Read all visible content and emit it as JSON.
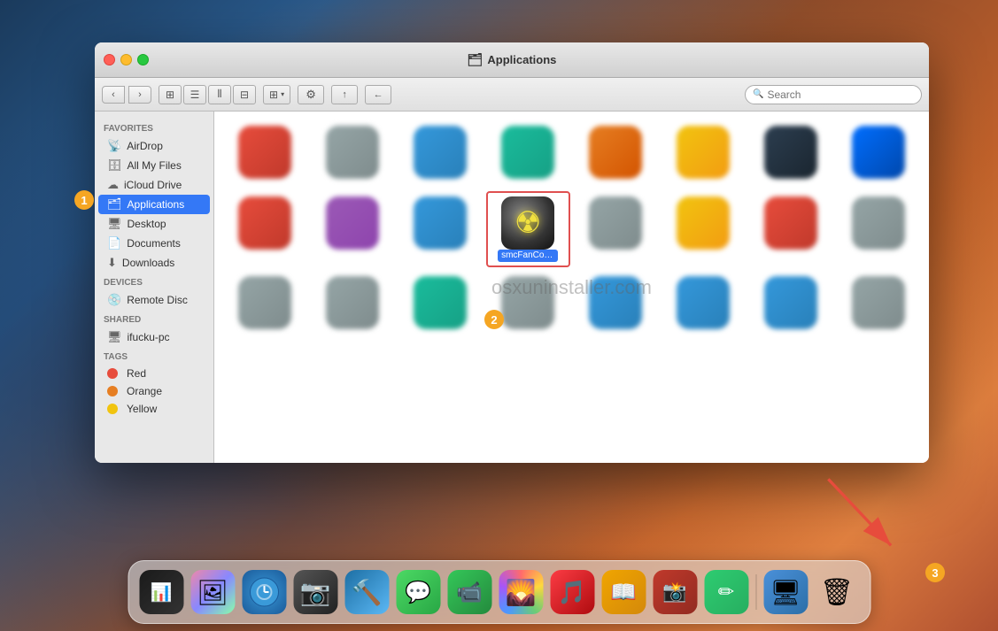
{
  "desktop": {
    "bg_desc": "macOS Sierra mountain wallpaper"
  },
  "window": {
    "title": "Applications",
    "title_icon": "🗂"
  },
  "toolbar": {
    "back_label": "‹",
    "forward_label": "›",
    "view_icon_grid": "⊞",
    "view_icon_list": "≡",
    "view_icon_column": "⫴",
    "view_icon_cover": "⊟",
    "arrange_label": "⊞",
    "action_label": "⚙",
    "share_label": "↑",
    "path_label": "←",
    "search_placeholder": "Search"
  },
  "sidebar": {
    "favorites_header": "Favorites",
    "devices_header": "Devices",
    "shared_header": "Shared",
    "tags_header": "Tags",
    "items": [
      {
        "id": "airdrop",
        "label": "AirDrop",
        "icon": "📡"
      },
      {
        "id": "all-my-files",
        "label": "All My Files",
        "icon": "🗄"
      },
      {
        "id": "icloud-drive",
        "label": "iCloud Drive",
        "icon": "☁"
      },
      {
        "id": "applications",
        "label": "Applications",
        "icon": "🗂",
        "active": true
      },
      {
        "id": "desktop",
        "label": "Desktop",
        "icon": "🖥"
      },
      {
        "id": "documents",
        "label": "Documents",
        "icon": "📄"
      },
      {
        "id": "downloads",
        "label": "Downloads",
        "icon": "⬇"
      },
      {
        "id": "remote-disc",
        "label": "Remote Disc",
        "icon": "💿"
      },
      {
        "id": "ifucku-pc",
        "label": "ifucku-pc",
        "icon": "🖥"
      }
    ],
    "tags": [
      {
        "id": "red",
        "label": "Red",
        "color": "#e74c3c"
      },
      {
        "id": "orange",
        "label": "Orange",
        "color": "#e67e22"
      },
      {
        "id": "yellow",
        "label": "Yellow",
        "color": "#f1c40f"
      }
    ]
  },
  "apps_grid": [
    {
      "id": "app1",
      "label": "",
      "icon_type": "blurred",
      "color": "icon-red"
    },
    {
      "id": "app2",
      "label": "",
      "icon_type": "blurred",
      "color": "icon-gray"
    },
    {
      "id": "app3",
      "label": "",
      "icon_type": "blurred",
      "color": "icon-blue"
    },
    {
      "id": "app4",
      "label": "",
      "icon_type": "blurred",
      "color": "icon-teal"
    },
    {
      "id": "app5",
      "label": "",
      "icon_type": "blurred",
      "color": "icon-orange"
    },
    {
      "id": "app6",
      "label": "",
      "icon_type": "blurred",
      "color": "icon-yellow"
    },
    {
      "id": "app7",
      "label": "",
      "icon_type": "blurred",
      "color": "icon-darkblue"
    },
    {
      "id": "app8",
      "label": "",
      "icon_type": "blurred",
      "color": "icon-safari"
    },
    {
      "id": "app9",
      "label": "",
      "icon_type": "blurred",
      "color": "icon-red"
    },
    {
      "id": "app10",
      "label": "",
      "icon_type": "blurred",
      "color": "icon-purple"
    },
    {
      "id": "app11",
      "label": "",
      "icon_type": "blurred",
      "color": "icon-blue"
    },
    {
      "id": "app12",
      "label": "",
      "icon_type": "blurred",
      "color": "icon-photos"
    },
    {
      "id": "app13",
      "label": "",
      "icon_type": "blurred",
      "color": "icon-teal"
    },
    {
      "id": "app14",
      "label": "",
      "icon_type": "blurred",
      "color": "icon-gray"
    },
    {
      "id": "app15",
      "label": "",
      "icon_type": "blurred",
      "color": "icon-gray"
    },
    {
      "id": "app16",
      "label": "",
      "icon_type": "blurred",
      "color": "icon-safari"
    },
    {
      "id": "smcfancontrol",
      "label": "smcFanControl",
      "icon_type": "smc",
      "selected": true
    },
    {
      "id": "app18",
      "label": "",
      "icon_type": "blurred",
      "color": "icon-red"
    },
    {
      "id": "app19",
      "label": "",
      "icon_type": "blurred",
      "color": "icon-pink"
    },
    {
      "id": "app20",
      "label": "",
      "icon_type": "blurred",
      "color": "icon-gray"
    },
    {
      "id": "app21",
      "label": "",
      "icon_type": "blurred",
      "color": "icon-red"
    },
    {
      "id": "app22",
      "label": "",
      "icon_type": "blurred",
      "color": "icon-yellow"
    },
    {
      "id": "app23",
      "label": "",
      "icon_type": "blurred",
      "color": "icon-gray"
    },
    {
      "id": "app24",
      "label": "",
      "icon_type": "blurred",
      "color": "icon-gray"
    },
    {
      "id": "app25",
      "label": "",
      "icon_type": "blurred",
      "color": "icon-gray"
    },
    {
      "id": "app26",
      "label": "",
      "icon_type": "blurred",
      "color": "icon-gray"
    },
    {
      "id": "app27",
      "label": "",
      "icon_type": "blurred",
      "color": "icon-teal"
    },
    {
      "id": "app28",
      "label": "",
      "icon_type": "blurred",
      "color": "icon-blue"
    },
    {
      "id": "app29",
      "label": "",
      "icon_type": "blurred",
      "color": "icon-gray"
    },
    {
      "id": "app30",
      "label": "",
      "icon_type": "blurred",
      "color": "icon-blue"
    },
    {
      "id": "app31",
      "label": "",
      "icon_type": "blurred",
      "color": "icon-blue"
    },
    {
      "id": "app32",
      "label": "",
      "icon_type": "blurred",
      "color": "icon-gray"
    }
  ],
  "badges": [
    {
      "id": "badge1",
      "number": "1"
    },
    {
      "id": "badge2",
      "number": "2"
    },
    {
      "id": "badge3",
      "number": "3"
    }
  ],
  "watermark": {
    "text": "osxuninstaller.com"
  },
  "dock": {
    "items": [
      {
        "id": "activity-monitor",
        "label": "Activity Monitor",
        "icon": "📊"
      },
      {
        "id": "photo-slideshow",
        "label": "Photo Slideshow",
        "icon": "🖼"
      },
      {
        "id": "quicksilver",
        "label": "Quicksilver",
        "icon": "🔵"
      },
      {
        "id": "image-capture",
        "label": "Image Capture",
        "icon": "📷"
      },
      {
        "id": "xcode",
        "label": "Xcode",
        "icon": "🔨"
      },
      {
        "id": "messages",
        "label": "Messages",
        "icon": "💬"
      },
      {
        "id": "facetime",
        "label": "FaceTime",
        "icon": "📹"
      },
      {
        "id": "photos",
        "label": "Photos",
        "icon": "🌄"
      },
      {
        "id": "music",
        "label": "Music",
        "icon": "🎵"
      },
      {
        "id": "books",
        "label": "Books",
        "icon": "📖"
      },
      {
        "id": "photo-booth",
        "label": "Photo Booth",
        "icon": "📸"
      },
      {
        "id": "sketchbook",
        "label": "Sketchbook",
        "icon": "✏"
      },
      {
        "id": "finder2",
        "label": "Finder",
        "icon": "🖥"
      },
      {
        "id": "trash",
        "label": "Trash",
        "icon": "🗑"
      }
    ]
  }
}
